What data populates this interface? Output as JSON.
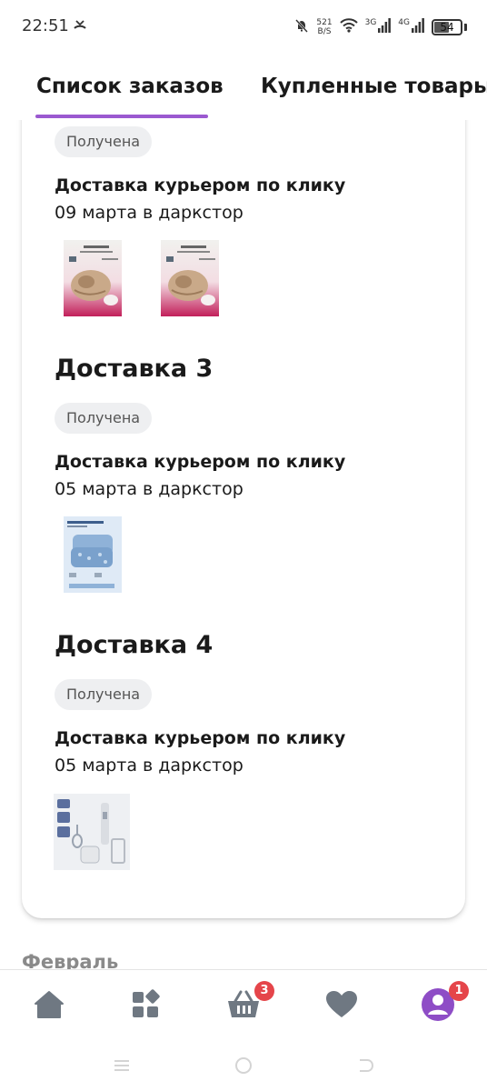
{
  "status": {
    "time": "22:51",
    "net_speed_value": "521",
    "net_speed_unit": "B/S",
    "net1": "3G",
    "net2": "4G",
    "battery": "54"
  },
  "tabs": [
    {
      "label": "Список заказов",
      "active": true
    },
    {
      "label": "Купленные товары",
      "active": false
    }
  ],
  "deliveries": [
    {
      "status": "Получена",
      "method": "Доставка курьером по клику",
      "date": "09 марта в даркстор",
      "products": [
        "blanket-product-image",
        "blanket-product-image"
      ]
    },
    {
      "title": "Доставка 3",
      "status": "Получена",
      "method": "Доставка курьером по клику",
      "date": "05 марта в даркстор",
      "products": [
        "pillows-product-image"
      ]
    },
    {
      "title": "Доставка 4",
      "status": "Получена",
      "method": "Доставка курьером по клику",
      "date": "05 марта в даркстор",
      "products": [
        "blender-product-image"
      ]
    }
  ],
  "month_label": "Февраль",
  "bottom_nav": {
    "home": "home-icon",
    "catalog": "catalog-icon",
    "cart": "cart-icon",
    "cart_badge": "3",
    "favorites": "heart-icon",
    "profile": "profile-icon",
    "profile_badge": "1"
  },
  "colors": {
    "accent": "#9b59d0",
    "badge_red": "#e5454a",
    "icon_gray": "#6f7882",
    "status_chip": "#eeeff1"
  }
}
